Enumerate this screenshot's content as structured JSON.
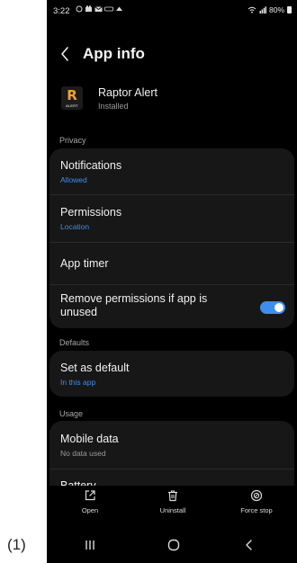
{
  "figure_label": "(1)",
  "status_bar": {
    "time": "3:22",
    "battery_text": "80%",
    "icons_left": [
      "settings-ring-icon",
      "app-notification-icon",
      "mail-icon",
      "network-icon",
      "cloud-icon"
    ],
    "icons_right": [
      "wifi-icon",
      "signal-icon",
      "battery-icon"
    ]
  },
  "header": {
    "title": "App info",
    "back_icon": "chevron-left-icon"
  },
  "app": {
    "name": "Raptor Alert",
    "status": "Installed",
    "icon_letter": "R",
    "icon_subtext": "ALERT",
    "icon_accent_color": "#f2a52a"
  },
  "sections": {
    "privacy": "Privacy",
    "defaults": "Defaults",
    "usage": "Usage"
  },
  "privacy_items": {
    "notifications": {
      "title": "Notifications",
      "subtitle": "Allowed"
    },
    "permissions": {
      "title": "Permissions",
      "subtitle": "Location"
    },
    "app_timer": {
      "title": "App timer"
    },
    "remove_permissions": {
      "title": "Remove permissions if app is unused",
      "toggle_on": true
    }
  },
  "defaults_items": {
    "set_as_default": {
      "title": "Set as default",
      "subtitle": "In this app"
    }
  },
  "usage_items": {
    "mobile_data": {
      "title": "Mobile data",
      "subtitle": "No data used"
    },
    "battery": {
      "title": "Battery"
    }
  },
  "bottom_actions": {
    "open": "Open",
    "uninstall": "Uninstall",
    "force_stop": "Force stop"
  },
  "navigation": {
    "recent": "recent-apps-icon",
    "home": "home-icon",
    "back": "back-icon"
  },
  "colors": {
    "background": "#000000",
    "card": "#171717",
    "accent_blue": "#3d8ef0",
    "text_primary": "#f2f2f2",
    "text_secondary": "#9a9a9a"
  }
}
